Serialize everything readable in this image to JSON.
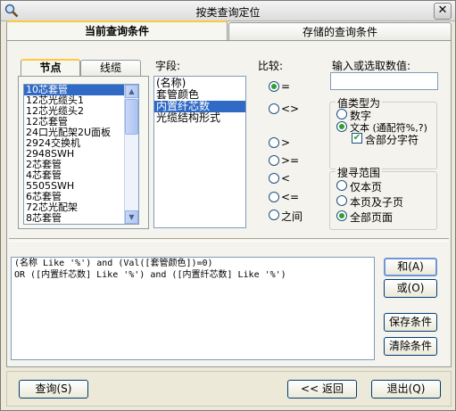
{
  "window": {
    "title": "按类查询定位",
    "close_glyph": "✕"
  },
  "tabs": [
    {
      "label": "当前查询条件"
    },
    {
      "label": "存储的查询条件"
    }
  ],
  "left_tabs": [
    {
      "label": "节点"
    },
    {
      "label": "线缆"
    }
  ],
  "node_list": [
    "10芯套管",
    "12芯光缆头1",
    "12芯光缆头2",
    "12芯套管",
    "24口光配架2U面板",
    "2924交换机",
    "2948SWH",
    "2芯套管",
    "4芯套管",
    "5505SWH",
    "6芯套管",
    "72芯光配架",
    "8芯套管"
  ],
  "field": {
    "label": "字段:",
    "items": [
      "(名称)",
      "套管颜色",
      "内置纤芯数",
      "光缆结构形式"
    ],
    "selected": 2
  },
  "compare": {
    "label": "比较:",
    "options": [
      "=",
      "<>",
      ">",
      ">=",
      "<",
      "<=",
      "之间"
    ],
    "selected": 0
  },
  "value_input": {
    "label": "输入或选取数值:",
    "value": ""
  },
  "value_type": {
    "title": "值类型为",
    "options": [
      "数字",
      "文本 (通配符%,?)"
    ],
    "selected": 1,
    "partial_match_label": "含部分字符",
    "partial_match_checked": true
  },
  "search_scope": {
    "title": "搜寻范围",
    "options": [
      "仅本页",
      "本页及子页",
      "全部页面"
    ],
    "selected": 2
  },
  "query_lines": [
    "(名称 Like '%') and (Val([套管颜色])=0)",
    "OR ([内置纤芯数] Like '%') and ([内置纤芯数] Like '%')"
  ],
  "side_buttons": {
    "and": "和(A)",
    "or": "或(O)",
    "save": "保存条件",
    "clear": "清除条件"
  },
  "bottom_buttons": {
    "query": "查询(S)",
    "back": "<< 返回",
    "exit": "退出(Q)"
  }
}
